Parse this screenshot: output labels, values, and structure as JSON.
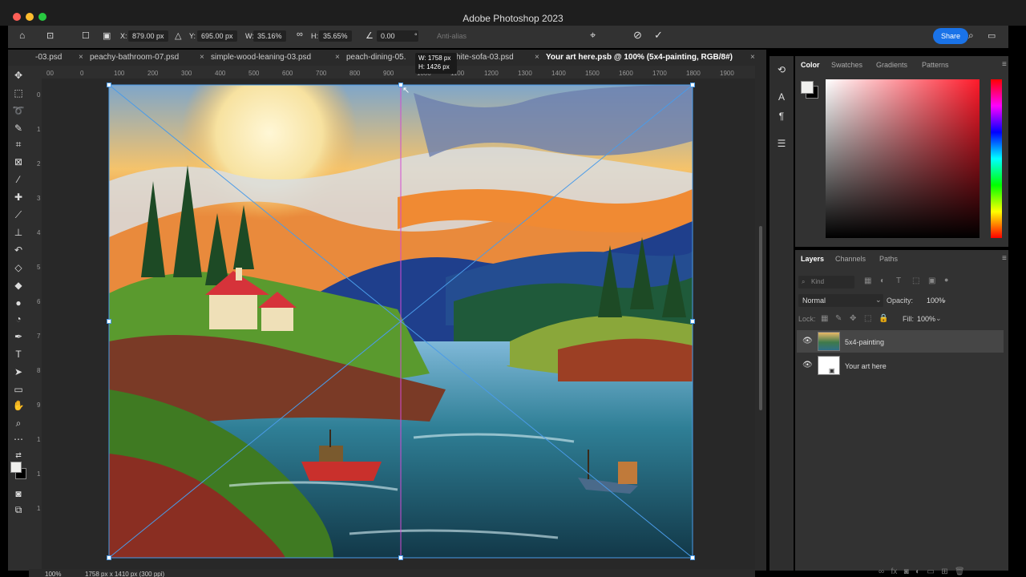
{
  "window": {
    "title": "Adobe Photoshop 2023"
  },
  "options": {
    "x": "879.00 px",
    "y": "695.00 px",
    "w": "35.16%",
    "h": "35.65%",
    "angle": "0.00",
    "angle_unit": "°",
    "antialias": "Anti-alias",
    "share": "Share",
    "x_label": "X:",
    "y_label": "Y:",
    "w_label": "W:",
    "h_label": "H:"
  },
  "tabs": [
    {
      "label": "-03.psd"
    },
    {
      "label": "peachy-bathroom-07.psd"
    },
    {
      "label": "simple-wood-leaning-03.psd"
    },
    {
      "label": "peach-dining-05."
    },
    {
      "label": "hite-sofa-03.psd"
    },
    {
      "label": "Your art here.psb @ 100% (5x4-painting, RGB/8#)"
    }
  ],
  "tooltip": {
    "w": "W: 1758 px",
    "h": "H: 1426 px"
  },
  "ruler_h": [
    "00",
    "0",
    "100",
    "200",
    "300",
    "400",
    "500",
    "600",
    "700",
    "800",
    "900",
    "1000",
    "1100",
    "1200",
    "1300",
    "1400",
    "1500",
    "1600",
    "1700",
    "1800",
    "1900"
  ],
  "ruler_v": [
    "0",
    "1",
    "2",
    "3",
    "4",
    "5",
    "6",
    "7",
    "8",
    "9",
    "1",
    "1",
    "1"
  ],
  "status": {
    "zoom": "100%",
    "doc": "1758 px x 1410 px (300 ppi)"
  },
  "color_panel": {
    "tabs": [
      "Color",
      "Swatches",
      "Gradients",
      "Patterns"
    ]
  },
  "layers_panel": {
    "tabs": [
      "Layers",
      "Channels",
      "Paths"
    ],
    "kind": "Kind",
    "blend": "Normal",
    "opacity_label": "Opacity:",
    "opacity": "100%",
    "lock_label": "Lock:",
    "fill_label": "Fill:",
    "fill": "100%",
    "layers": [
      {
        "name": "5x4-painting",
        "selected": true
      },
      {
        "name": "Your art here",
        "selected": false
      }
    ]
  }
}
